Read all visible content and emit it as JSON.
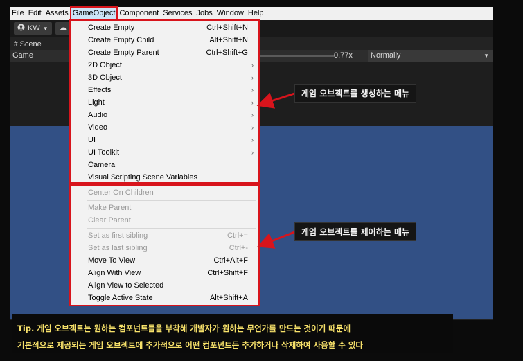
{
  "menubar": {
    "items": [
      "File",
      "Edit",
      "Assets",
      "GameObject",
      "Component",
      "Services",
      "Jobs",
      "Window",
      "Help"
    ]
  },
  "toolbar": {
    "account": "KW"
  },
  "tabs": {
    "scene": "Scene"
  },
  "gamebar": {
    "display": "Game",
    "zoom": "0.77x",
    "mode": "Normally"
  },
  "menu": {
    "items": [
      {
        "label": "Create Empty",
        "shortcut": "Ctrl+Shift+N",
        "enabled": true
      },
      {
        "label": "Create Empty Child",
        "shortcut": "Alt+Shift+N",
        "enabled": true
      },
      {
        "label": "Create Empty Parent",
        "shortcut": "Ctrl+Shift+G",
        "enabled": true
      },
      {
        "label": "2D Object",
        "submenu": true,
        "enabled": true
      },
      {
        "label": "3D Object",
        "submenu": true,
        "enabled": true
      },
      {
        "label": "Effects",
        "submenu": true,
        "enabled": true
      },
      {
        "label": "Light",
        "submenu": true,
        "enabled": true
      },
      {
        "label": "Audio",
        "submenu": true,
        "enabled": true
      },
      {
        "label": "Video",
        "submenu": true,
        "enabled": true
      },
      {
        "label": "UI",
        "submenu": true,
        "enabled": true
      },
      {
        "label": "UI Toolkit",
        "submenu": true,
        "enabled": true
      },
      {
        "label": "Camera",
        "enabled": true
      },
      {
        "label": "Visual Scripting Scene Variables",
        "enabled": true
      },
      {
        "label": "Center On Children",
        "enabled": false
      },
      {
        "label": "Make Parent",
        "enabled": false
      },
      {
        "label": "Clear Parent",
        "enabled": false
      },
      {
        "label": "Set as first sibling",
        "shortcut": "Ctrl+=",
        "enabled": false
      },
      {
        "label": "Set as last sibling",
        "shortcut": "Ctrl+-",
        "enabled": false
      },
      {
        "label": "Move To View",
        "shortcut": "Ctrl+Alt+F",
        "enabled": true
      },
      {
        "label": "Align With View",
        "shortcut": "Ctrl+Shift+F",
        "enabled": true
      },
      {
        "label": "Align View to Selected",
        "enabled": true
      },
      {
        "label": "Toggle Active State",
        "shortcut": "Alt+Shift+A",
        "enabled": true
      }
    ]
  },
  "annotations": {
    "create_menu": "게임 오브젝트를 생성하는 메뉴",
    "control_menu": "게임 오브젝트를 제어하는 메뉴"
  },
  "tip": {
    "line1": "Tip. 게임 오브젝트는 원하는 컴포넌트들을 부착해 개발자가 원하는 무언가를 만드는 것이기 때문에",
    "line2": "기본적으로 제공되는 게임 오브젝트에 추가적으로 어떤 컴포넌트든 추가하거나 삭제하여 사용할 수 있다"
  },
  "colors": {
    "highlight_red": "#d8141c",
    "scene_blue": "#325085",
    "tip_text": "#f7e16a"
  }
}
